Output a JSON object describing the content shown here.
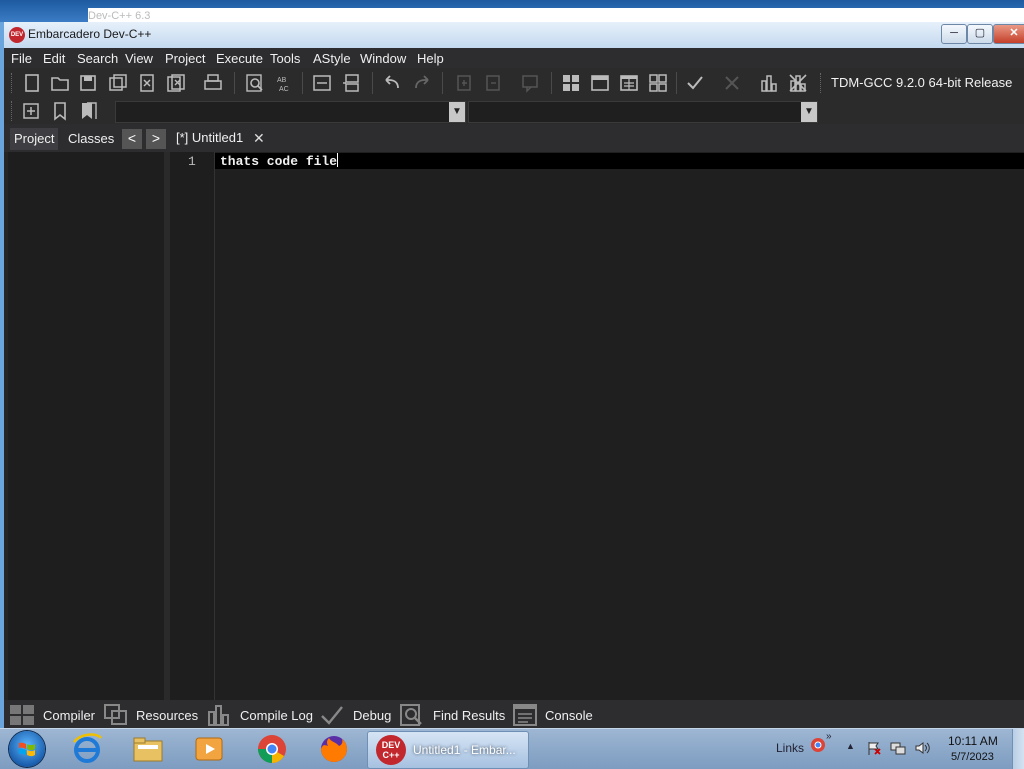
{
  "background_window": {
    "title": "Dev-C++ 6.3"
  },
  "window": {
    "title": "Embarcadero Dev-C++",
    "app_icon": "devcpp-logo-icon",
    "controls": {
      "minimize": "minimize-icon",
      "maximize": "maximize-icon",
      "close": "close-icon"
    }
  },
  "menu": {
    "items": [
      "File",
      "Edit",
      "Search",
      "View",
      "Project",
      "Execute",
      "Tools",
      "AStyle",
      "Window",
      "Help"
    ]
  },
  "toolbar": {
    "compiler_label": "TDM-GCC 9.2.0 64-bit Release",
    "combo_left": {
      "value": ""
    },
    "combo_right": {
      "value": ""
    },
    "icons": [
      "new-file-icon",
      "open-file-icon",
      "save-icon",
      "save-all-icon",
      "close-file-icon",
      "close-all-icon",
      "print-icon",
      "find-icon",
      "replace-icon",
      "indent-icon",
      "unindent-icon",
      "undo-icon",
      "redo-icon",
      "bookmark-icon",
      "goto-line-icon",
      "comment-icon",
      "compile-icon",
      "run-icon",
      "compile-run-icon",
      "rebuild-icon",
      "syntax-check-icon",
      "stop-icon",
      "profile-icon",
      "delete-profile-icon",
      "new-project-icon",
      "bookmark-toggle-icon",
      "goto-bookmark-icon"
    ]
  },
  "left_panel": {
    "tabs": [
      "Project",
      "Classes"
    ],
    "active_tab": "Project",
    "nav": {
      "prev": "<",
      "next": ">"
    }
  },
  "editor": {
    "tab_label": "[*] Untitled1",
    "tab_close": "✕",
    "lines": [
      {
        "number": "1",
        "text": "thats code file"
      }
    ]
  },
  "bottom_tabs": [
    {
      "label": "Compiler",
      "icon": "compiler-grid-icon"
    },
    {
      "label": "Resources",
      "icon": "resources-icon"
    },
    {
      "label": "Compile Log",
      "icon": "compile-log-chart-icon"
    },
    {
      "label": "Debug",
      "icon": "debug-check-icon"
    },
    {
      "label": "Find Results",
      "icon": "find-results-icon"
    },
    {
      "label": "Console",
      "icon": "console-icon"
    }
  ],
  "taskbar": {
    "pinned": [
      "internet-explorer-icon",
      "file-explorer-icon",
      "media-player-icon",
      "chrome-icon",
      "firefox-icon"
    ],
    "active_app": {
      "logo_text": "DEV C++",
      "label": "Untitled1 - Embar..."
    },
    "links": "Links",
    "time": "10:11 AM",
    "date": "5/7/2023"
  },
  "colors": {
    "editor_bg": "#1f1f1f",
    "menu_bg": "#2d2d30",
    "taskbar": "#8aa7c8",
    "brand_red": "#c1272d"
  }
}
